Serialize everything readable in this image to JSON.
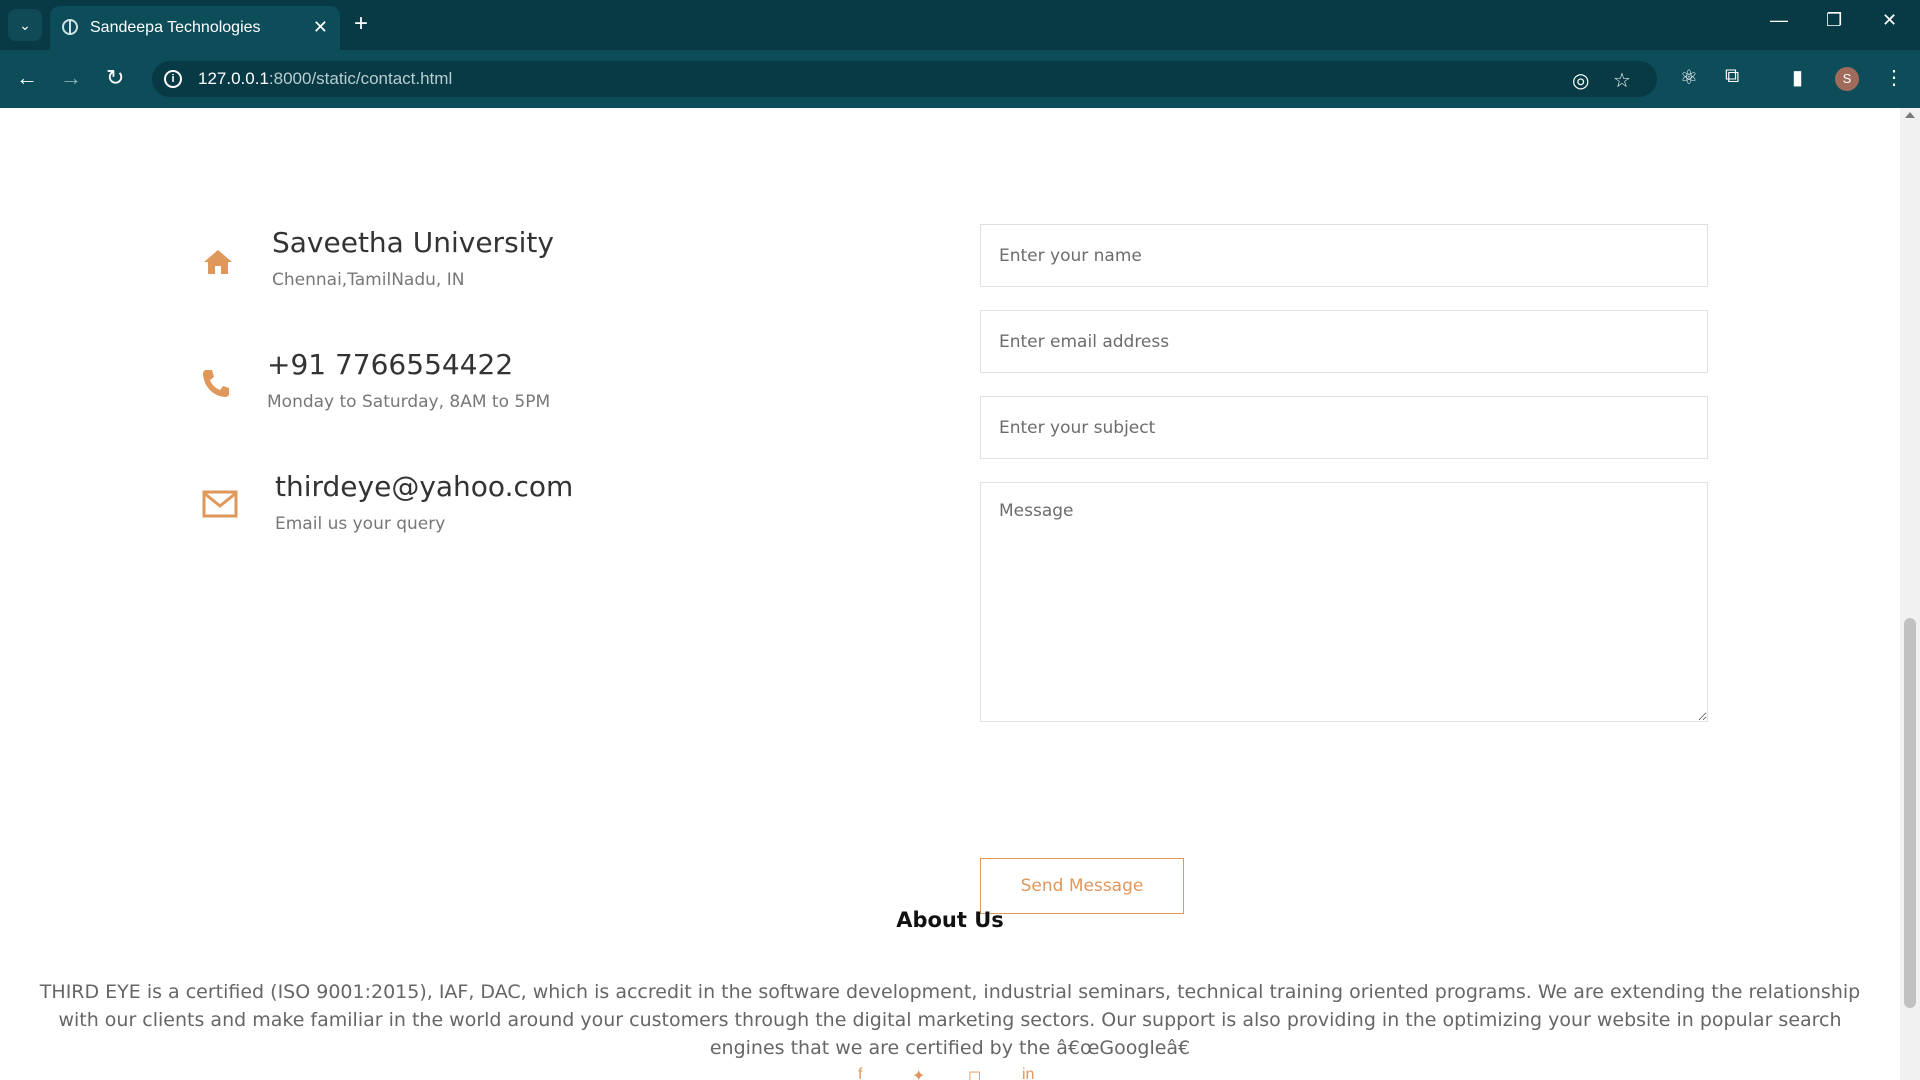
{
  "browser": {
    "tab_title": "Sandeepa Technologies",
    "url_host": "127.0.0.1",
    "url_path": ":8000/static/contact.html",
    "profile_initial": "S"
  },
  "contact_info": [
    {
      "icon": "home-icon",
      "title": "Saveetha University",
      "subtitle": "Chennai,TamilNadu, IN"
    },
    {
      "icon": "phone-icon",
      "title": "+91 7766554422",
      "subtitle": "Monday to Saturday, 8AM to 5PM"
    },
    {
      "icon": "mail-icon",
      "title": "thirdeye@yahoo.com",
      "subtitle": "Email us your query"
    }
  ],
  "form": {
    "name_placeholder": "Enter your name",
    "email_placeholder": "Enter email address",
    "subject_placeholder": "Enter your subject",
    "message_placeholder": "Message",
    "send_label": "Send Message"
  },
  "about": {
    "title": "About Us",
    "text": "THIRD EYE is a certified (ISO 9001:2015), IAF, DAC, which is accredit in the software development, industrial seminars, technical training oriented programs. We are extending the relationship with our clients and make familiar in the world around your customers through the digital marketing sectors. Our support is also providing in the optimizing your website in popular search engines that we are certified by the â€œGoogleâ€"
  },
  "colors": {
    "accent": "#e0975a",
    "chrome_dark": "#073a45",
    "chrome_toolbar": "#0d4d5a"
  }
}
